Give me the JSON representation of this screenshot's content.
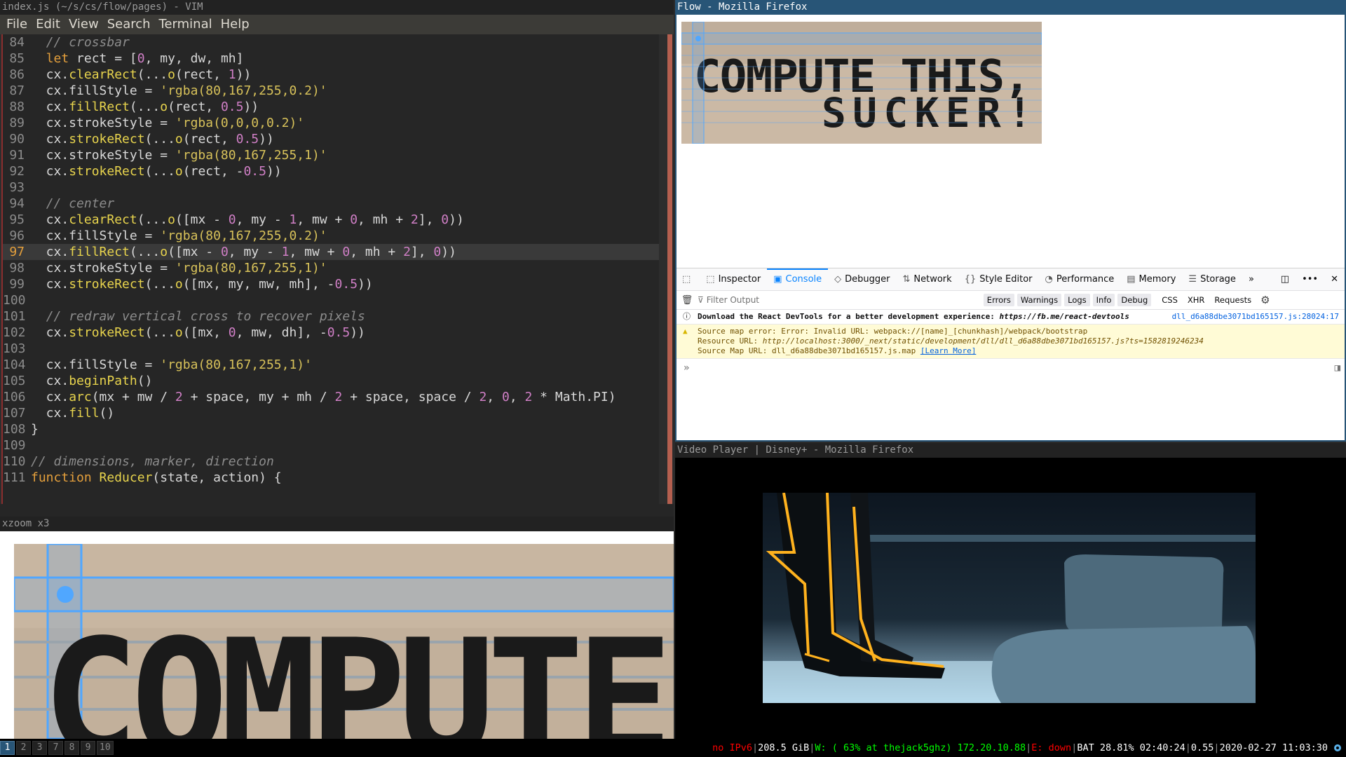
{
  "vim": {
    "title": "index.js (~/s/cs/flow/pages) - VIM",
    "menu": [
      "File",
      "Edit",
      "View",
      "Search",
      "Terminal",
      "Help"
    ],
    "current_line": 97,
    "lines": [
      {
        "n": "84",
        "code": "  // crossbar"
      },
      {
        "n": "85",
        "code": "  let rect = [0, my, dw, mh]"
      },
      {
        "n": "86",
        "code": "  cx.clearRect(...o(rect, 1))"
      },
      {
        "n": "87",
        "code": "  cx.fillStyle = 'rgba(80,167,255,0.2)'"
      },
      {
        "n": "88",
        "code": "  cx.fillRect(...o(rect, 0.5))"
      },
      {
        "n": "89",
        "code": "  cx.strokeStyle = 'rgba(0,0,0,0.2)'"
      },
      {
        "n": "90",
        "code": "  cx.strokeRect(...o(rect, 0.5))"
      },
      {
        "n": "91",
        "code": "  cx.strokeStyle = 'rgba(80,167,255,1)'"
      },
      {
        "n": "92",
        "code": "  cx.strokeRect(...o(rect, -0.5))"
      },
      {
        "n": "93",
        "code": ""
      },
      {
        "n": "94",
        "code": "  // center"
      },
      {
        "n": "95",
        "code": "  cx.clearRect(...o([mx - 0, my - 1, mw + 0, mh + 2], 0))"
      },
      {
        "n": "96",
        "code": "  cx.fillStyle = 'rgba(80,167,255,0.2)'"
      },
      {
        "n": "97",
        "code": "  cx.fillRect(...o([mx - 0, my - 1, mw + 0, mh + 2], 0))"
      },
      {
        "n": "98",
        "code": "  cx.strokeStyle = 'rgba(80,167,255,1)'"
      },
      {
        "n": "99",
        "code": "  cx.strokeRect(...o([mx, my, mw, mh], -0.5))"
      },
      {
        "n": "100",
        "code": ""
      },
      {
        "n": "101",
        "code": "  // redraw vertical cross to recover pixels"
      },
      {
        "n": "102",
        "code": "  cx.strokeRect(...o([mx, 0, mw, dh], -0.5))"
      },
      {
        "n": "103",
        "code": ""
      },
      {
        "n": "104",
        "code": "  cx.fillStyle = 'rgba(80,167,255,1)'"
      },
      {
        "n": "105",
        "code": "  cx.beginPath()"
      },
      {
        "n": "106",
        "code": "  cx.arc(mx + mw / 2 + space, my + mh / 2 + space, space / 2, 0, 2 * Math.PI)"
      },
      {
        "n": "107",
        "code": "  cx.fill()"
      },
      {
        "n": "108",
        "code": "}"
      },
      {
        "n": "109",
        "code": ""
      },
      {
        "n": "110",
        "code": "// dimensions, marker, direction"
      },
      {
        "n": "111",
        "code": "function Reducer(state, action) {"
      }
    ]
  },
  "xzoom": {
    "title": "xzoom x3",
    "image_text": "COMPUTE"
  },
  "firefox_dev": {
    "title": "Flow - Mozilla Firefox",
    "image_text_line1": "COMPUTE THIS,",
    "image_text_line2": "SUCKER!",
    "devtools": {
      "tabs": [
        {
          "label": "Inspector",
          "icon": "inspector-icon",
          "glyph": "⬚"
        },
        {
          "label": "Console",
          "icon": "console-icon",
          "glyph": "▣",
          "active": true
        },
        {
          "label": "Debugger",
          "icon": "debugger-icon",
          "glyph": "◇"
        },
        {
          "label": "Network",
          "icon": "network-icon",
          "glyph": "⇅"
        },
        {
          "label": "Style Editor",
          "icon": "style-editor-icon",
          "glyph": "{}"
        },
        {
          "label": "Performance",
          "icon": "performance-icon",
          "glyph": "◔"
        },
        {
          "label": "Memory",
          "icon": "memory-icon",
          "glyph": "▤"
        },
        {
          "label": "Storage",
          "icon": "storage-icon",
          "glyph": "☰"
        }
      ],
      "filter_placeholder": "Filter Output",
      "filter_chips": [
        "Errors",
        "Warnings",
        "Logs",
        "Info",
        "Debug"
      ],
      "filter_plain": [
        "CSS",
        "XHR",
        "Requests"
      ],
      "messages": [
        {
          "type": "info",
          "text_prefix": "Download the React DevTools for a better development experience: ",
          "text_link": "https://fb.me/react-devtools",
          "source": "dll_d6a88dbe3071bd165157.js:28024:17"
        },
        {
          "type": "warn",
          "line1": "Source map error: Error: Invalid URL: webpack://[name]_[chunkhash]/webpack/bootstrap",
          "line2_label": "Resource URL: ",
          "line2_value": "http://localhost:3000/_next/static/development/dll/dll_d6a88dbe3071bd165157.js?ts=1582819246234",
          "line3_label": "Source Map URL: dll_d6a88dbe3071bd165157.js.map ",
          "line3_link": "[Learn More]"
        }
      ]
    }
  },
  "video_player": {
    "title": "Video Player | Disney+ - Mozilla Firefox"
  },
  "statusbar": {
    "workspaces": [
      "1",
      "2",
      "3",
      "7",
      "8",
      "9",
      "10"
    ],
    "active_workspace": "1",
    "ipv6": "no IPv6",
    "disk": "208.5 GiB",
    "wifi": "W: ( 63% at thejack5ghz) 172.20.10.88",
    "ethernet": "E: down",
    "battery": "BAT 28.81% 02:40:24",
    "load": "0.55",
    "datetime": "2020-02-27 11:03:30"
  },
  "colors": {
    "focused_title": "#285577",
    "accent_blue": "#0a84ff",
    "marker_blue": "#50a7ff"
  }
}
